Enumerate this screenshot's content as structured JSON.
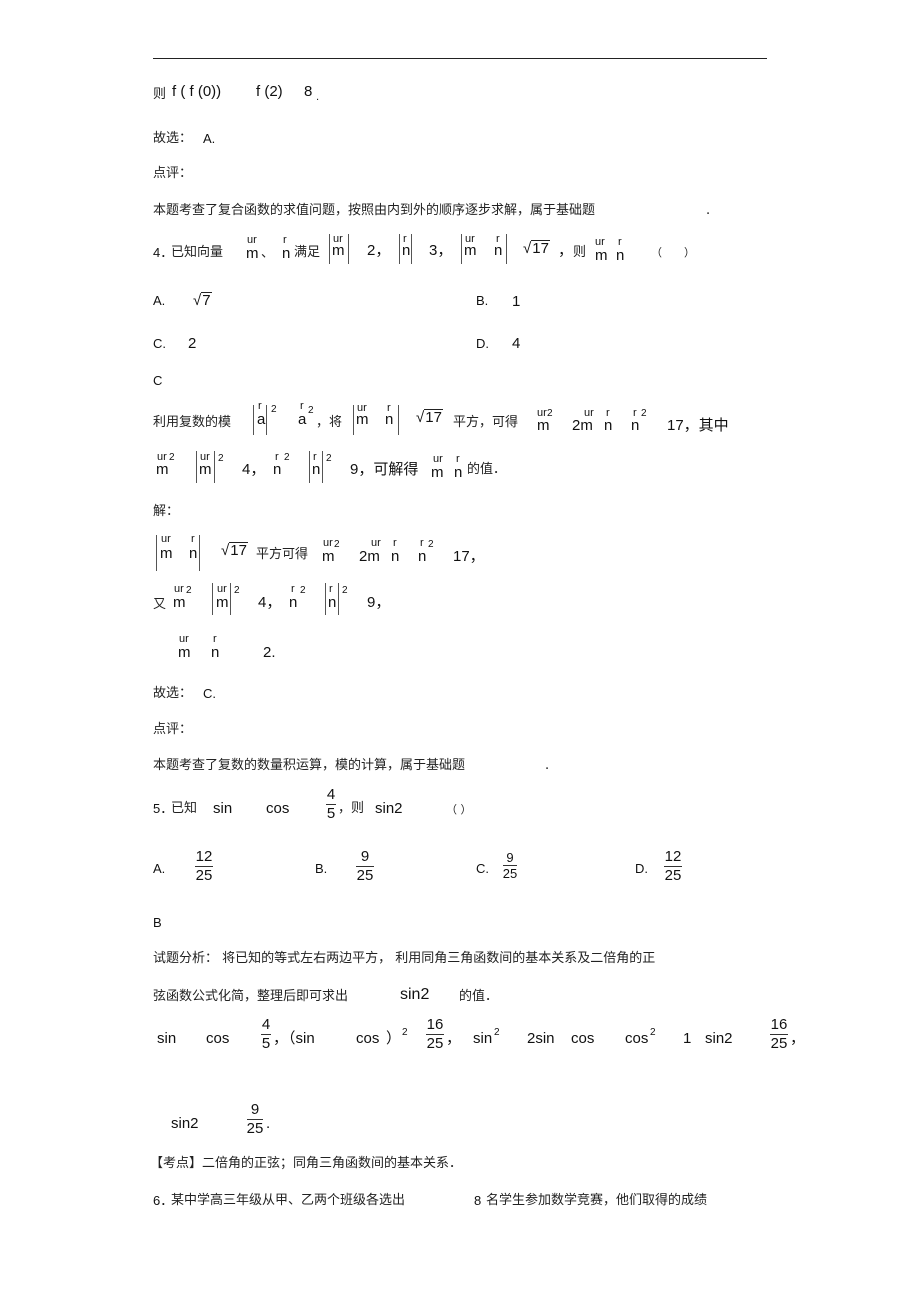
{
  "prev_solution": {
    "line1": {
      "prefix": "则",
      "expr1": "f ( f (0))",
      "expr2": "f (2)",
      "val": "8",
      "end": "."
    },
    "answer": {
      "label": "故选：",
      "value": "A."
    },
    "review_label": "点评：",
    "review_text": "本题考查了复合函数的求值问题，按照由内到外的顺序逐步求解，属于基础题",
    "review_end": "."
  },
  "q4": {
    "num": "4．",
    "stem_a": "已知向量",
    "vec_arrow_m": "ur",
    "vec_arrow_n": "r",
    "m": "m",
    "n": "n",
    "sep": "、",
    "stem_b": "满足",
    "val_m": "2，",
    "val_n": "3，",
    "sqrt17": "17",
    "comma": "，",
    "stem_c": "则",
    "paren": "（　　）",
    "options": [
      {
        "label": "A.",
        "value": "7",
        "is_sqrt": true
      },
      {
        "label": "B.",
        "value": "1"
      },
      {
        "label": "C.",
        "value": "2"
      },
      {
        "label": "D.",
        "value": "4"
      }
    ],
    "answer_letter": "C",
    "analysis": {
      "a1": "利用复数的模",
      "a_letter": "a",
      "sup2": "2",
      "a2": "，将",
      "a3": "平方，可得",
      "two_m": "2m",
      "v17": "17，其中",
      "v4": "4，",
      "v9": "9，可解得",
      "a4": "的值．"
    },
    "solution": {
      "label": "解：",
      "s1": "平方可得",
      "v17": "17，",
      "s2": "又",
      "v4": "4，",
      "v9": "9，",
      "result": "2."
    },
    "answer": {
      "label": "故选：",
      "value": "C."
    },
    "review_label": "点评：",
    "review_text": "本题考查了复数的数量积运算，模的计算，属于基础题",
    "review_end": "."
  },
  "q5": {
    "num": "5．",
    "stem_a": "已知",
    "sin": "sin",
    "cos": "cos",
    "frac": {
      "num": "4",
      "den": "5"
    },
    "stem_b": "，则",
    "sin2": "sin2",
    "paren": "（  ）",
    "options": [
      {
        "label": "A.",
        "num": "12",
        "den": "25"
      },
      {
        "label": "B.",
        "num": "9",
        "den": "25"
      },
      {
        "label": "C.",
        "num": "9",
        "den": "25"
      },
      {
        "label": "D.",
        "num": "12",
        "den": "25"
      }
    ],
    "answer_letter": "B",
    "analysis_line1": "试题分析：  将已知的等式左右两边平方，    利用同角三角函数间的基本关系及二倍角的正",
    "analysis_line2a": "弦函数公式化简，整理后即可求出",
    "analysis_line2b": "sin2",
    "analysis_line2c": "的值．",
    "derivation": {
      "sin": "sin",
      "cos": "cos",
      "f1": {
        "num": "4",
        "den": "5"
      },
      "c1": "，（sin",
      "cos2": "cos",
      "paren_close": "）",
      "sup2": "2",
      "f2": {
        "num": "16",
        "den": "25"
      },
      "c2": "，",
      "sin_sq": "sin",
      "two_sin": "2sin",
      "cos_b": "cos",
      "cos_sq": "cos",
      "one": "1",
      "sin2": "sin2",
      "f3": {
        "num": "16",
        "den": "25"
      },
      "c3": "，"
    },
    "result": {
      "sin2": "sin2",
      "num": "9",
      "den": "25",
      "end": "."
    },
    "kaodian": "【考点】二倍角的正弦；同角三角函数间的基本关系．"
  },
  "q6": {
    "num": "6．",
    "stem_a": "某中学高三年级从甲、乙两个班级各选出",
    "count": "8",
    "stem_b": "名学生参加数学竞赛，他们取得的成绩"
  }
}
